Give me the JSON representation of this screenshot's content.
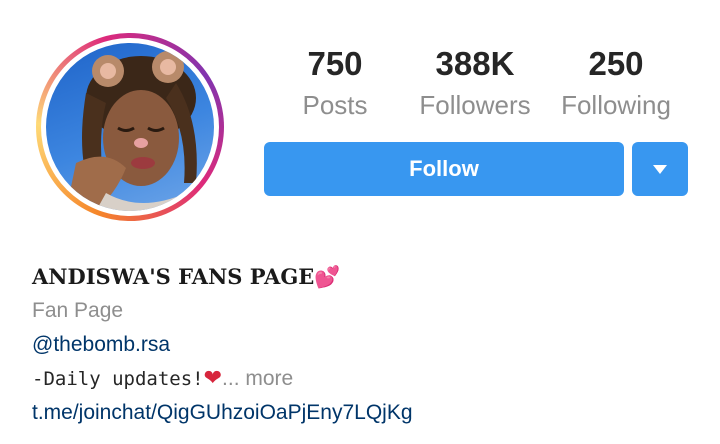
{
  "profile": {
    "stats": [
      {
        "value": "750",
        "label": "Posts"
      },
      {
        "value": "388K",
        "label": "Followers"
      },
      {
        "value": "250",
        "label": "Following"
      }
    ],
    "follow_label": "Follow",
    "name": "ANDISWA'S FANS PAGE",
    "name_emoji": "💕",
    "category": "Fan Page",
    "handle": "@thebomb.rsa",
    "bio_text": "-Daily updates!",
    "bio_emoji": "❤",
    "more_label": "... more",
    "link": "t.me/joinchat/QigGUhzoiOaPjEny7LQjKg"
  },
  "colors": {
    "accent": "#3897f0",
    "link": "#003569",
    "muted": "#8e8e8e",
    "text": "#262626"
  },
  "icons": {
    "dropdown": "chevron-down-icon",
    "avatar": "profile-photo"
  }
}
